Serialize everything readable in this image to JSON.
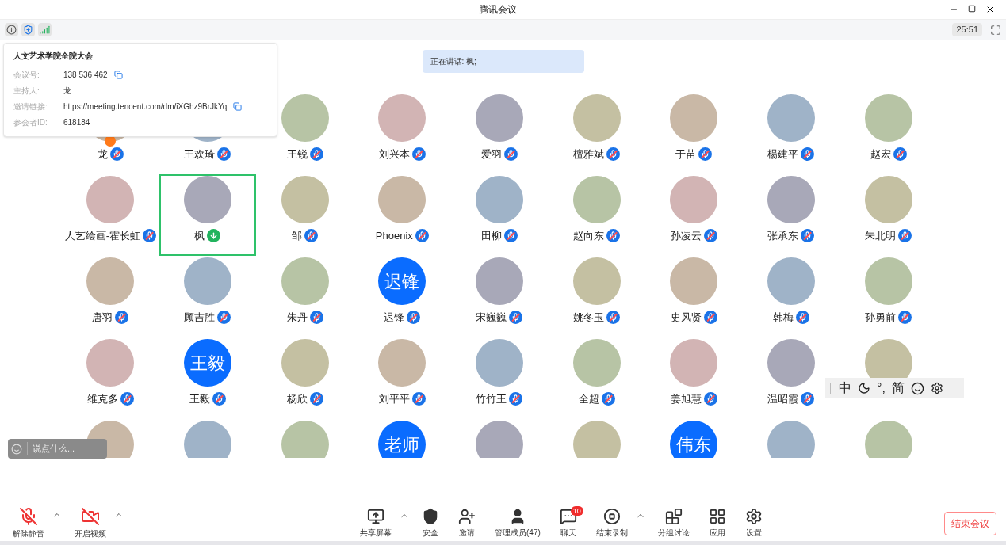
{
  "window": {
    "title": "腾讯会议"
  },
  "status_bar": {
    "timer": "25:51"
  },
  "meeting_info": {
    "title": "人文艺术学院全院大会",
    "fields": [
      {
        "label": "会议号:",
        "value": "138 536 462",
        "actions": [
          {
            "kind": "copy"
          }
        ]
      },
      {
        "label": "主持人:",
        "value": "龙"
      },
      {
        "label": "邀请链接:",
        "value": "https://meeting.tencent.com/dm/iXGhz9BrJkYq",
        "actions": [
          {
            "kind": "copy"
          }
        ]
      },
      {
        "label": "参会者ID:",
        "value": "618184"
      }
    ]
  },
  "speaker_banner": "正在讲话: 枫;",
  "participants": [
    {
      "name": "龙",
      "host": true,
      "speaking": false
    },
    {
      "name": "王欢琦",
      "host": false,
      "speaking": false
    },
    {
      "name": "王锐",
      "host": false,
      "speaking": false
    },
    {
      "name": "刘兴本",
      "host": false,
      "speaking": false
    },
    {
      "name": "爱羽",
      "host": false,
      "speaking": false
    },
    {
      "name": "檀雅斌",
      "host": false,
      "speaking": false
    },
    {
      "name": "于苗",
      "host": false,
      "speaking": false
    },
    {
      "name": "楊建平",
      "host": false,
      "speaking": false
    },
    {
      "name": "赵宏",
      "host": false,
      "speaking": false
    },
    {
      "name": "人艺绘画-霍长虹",
      "host": false,
      "speaking": false
    },
    {
      "name": "枫",
      "host": false,
      "speaking": true
    },
    {
      "name": "邹",
      "host": false,
      "speaking": false
    },
    {
      "name": "Phoenix",
      "host": false,
      "speaking": false
    },
    {
      "name": "田柳",
      "host": false,
      "speaking": false
    },
    {
      "name": "赵向东",
      "host": false,
      "speaking": false
    },
    {
      "name": "孙凌云",
      "host": false,
      "speaking": false
    },
    {
      "name": "张承东",
      "host": false,
      "speaking": false
    },
    {
      "name": "朱北明",
      "host": false,
      "speaking": false
    },
    {
      "name": "唐羽",
      "host": false,
      "speaking": false
    },
    {
      "name": "顾吉胜",
      "host": false,
      "speaking": false
    },
    {
      "name": "朱丹",
      "host": false,
      "speaking": false
    },
    {
      "name": "迟锋",
      "avatar_text": "迟锋",
      "host": false,
      "speaking": false
    },
    {
      "name": "宋巍巍",
      "host": false,
      "speaking": false
    },
    {
      "name": "姚冬玉",
      "host": false,
      "speaking": false
    },
    {
      "name": "史风贤",
      "host": false,
      "speaking": false
    },
    {
      "name": "韩梅",
      "host": false,
      "speaking": false
    },
    {
      "name": "孙勇前",
      "host": false,
      "speaking": false
    },
    {
      "name": "维克多",
      "host": false,
      "speaking": false
    },
    {
      "name": "王毅",
      "avatar_text": "王毅",
      "host": false,
      "speaking": false
    },
    {
      "name": "杨欣",
      "host": false,
      "speaking": false
    },
    {
      "name": "刘平平",
      "host": false,
      "speaking": false
    },
    {
      "name": "竹竹王",
      "host": false,
      "speaking": false
    },
    {
      "name": "全超",
      "host": false,
      "speaking": false
    },
    {
      "name": "姜旭慧",
      "host": false,
      "speaking": false
    },
    {
      "name": "温昭霞",
      "host": false,
      "speaking": false
    },
    {
      "kind": "photo"
    },
    {
      "kind": "photo"
    },
    {
      "kind": "photo"
    },
    {
      "kind": "photo"
    },
    {
      "kind": "text",
      "avatar_text": "老师"
    },
    {
      "kind": "photo"
    },
    {
      "kind": "photo"
    },
    {
      "kind": "text",
      "avatar_text": "伟东"
    },
    {
      "kind": "photo"
    },
    {
      "kind": "photo"
    }
  ],
  "chat_input": {
    "placeholder": "说点什么..."
  },
  "ime_toolbar": {
    "items": [
      "中",
      "°,",
      "简"
    ]
  },
  "toolbar": {
    "left": [
      {
        "kind": "mic",
        "label": "解除静音",
        "on": false
      },
      {
        "kind": "caret"
      },
      {
        "kind": "video",
        "label": "开启视频",
        "on": false
      },
      {
        "kind": "caret"
      }
    ],
    "center": [
      {
        "kind": "share",
        "label": "共享屏幕"
      },
      {
        "kind": "caret"
      },
      {
        "kind": "security",
        "label": "安全"
      },
      {
        "kind": "invite",
        "label": "邀请"
      },
      {
        "kind": "members",
        "label": "管理成员(47)"
      },
      {
        "kind": "chat",
        "label": "聊天",
        "badge": "10"
      },
      {
        "kind": "record",
        "label": "结束录制"
      },
      {
        "kind": "caret"
      },
      {
        "kind": "breakout",
        "label": "分组讨论"
      },
      {
        "kind": "apps",
        "label": "应用"
      },
      {
        "kind": "settings",
        "label": "设置"
      }
    ],
    "end_button": "结束会议"
  }
}
